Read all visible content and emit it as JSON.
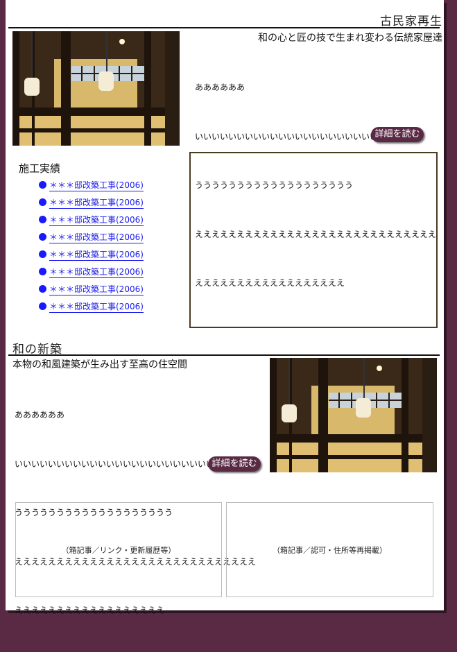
{
  "section1": {
    "title": "古民家再生",
    "tagline": "和の心と匠の技で生まれ変わる伝統家屋達",
    "lines": [
      "ああああああ",
      "いいいいいいいいいいいいいいいいいいいいいいいいいい",
      "ううううううううううううううううううう",
      "えええええええええええええええええええええええええええええ",
      "ええええええええええええええええええ"
    ],
    "read_more": "詳細を読む"
  },
  "works": {
    "heading": "施工実績",
    "items": [
      "＊＊＊邸改築工事(2006)",
      "＊＊＊邸改築工事(2006)",
      "＊＊＊邸改築工事(2006)",
      "＊＊＊邸改築工事(2006)",
      "＊＊＊邸改築工事(2006)",
      "＊＊＊邸改築工事(2006)",
      "＊＊＊邸改築工事(2006)",
      "＊＊＊邸改築工事(2006)"
    ]
  },
  "section2": {
    "title": "和の新築",
    "tagline": "本物の和風建築が生み出す至高の住空間",
    "lines": [
      "ああああああ",
      "いいいいいいいいいいいいいいいいいいいいいいいいいい",
      "ううううううううううううううううううう",
      "えええええええええええええええええええええええええええええ",
      "ええええええええええええええええええ"
    ],
    "read_more": "詳細を読む"
  },
  "bottom_boxes": {
    "left": "（箱記事／リンク・更新履歴等）",
    "right": "（箱記事／認可・住所等再掲載）"
  },
  "colors": {
    "background": "#5a2a45",
    "button": "#5a2a45",
    "link": "#1a1aee"
  }
}
